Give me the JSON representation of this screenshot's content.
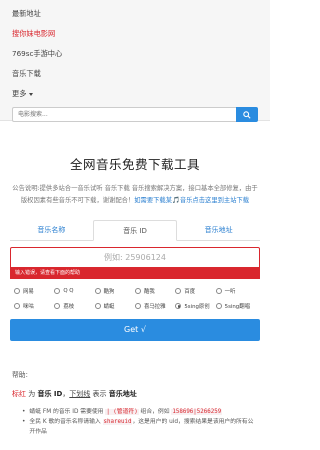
{
  "nav": {
    "items": [
      {
        "label": "最新地址",
        "active": false
      },
      {
        "label": "搜你妹电影网",
        "active": true
      },
      {
        "label": "769sc手游中心",
        "active": false
      },
      {
        "label": "音乐下载",
        "active": false
      }
    ],
    "more_label": "更多",
    "search_placeholder": "电影搜索..."
  },
  "main": {
    "title": "全网音乐免费下载工具",
    "notice_text": "公告说明:提供多站合一音乐试听 音乐下载 音乐搜索解决方案，接口基本全部修复，由于版权因素有些音乐不可下载，谢谢配合！",
    "notice_link": "如需要下载某🎵音乐点击这里到主站下载"
  },
  "tabs": [
    {
      "label": "音乐名称",
      "active": false
    },
    {
      "label": "音乐 ID",
      "active": true
    },
    {
      "label": "音乐地址",
      "active": false
    }
  ],
  "form": {
    "input_placeholder": "例如: 25906124",
    "error_text": "输入错误，请查看下面的帮助",
    "sources": [
      {
        "label": "网易",
        "checked": false
      },
      {
        "label": "Q Q",
        "checked": false
      },
      {
        "label": "酷狗",
        "checked": false
      },
      {
        "label": "酷我",
        "checked": false
      },
      {
        "label": "百度",
        "checked": false
      },
      {
        "label": "一听",
        "checked": false
      },
      {
        "label": "咪咕",
        "checked": false
      },
      {
        "label": "荔枝",
        "checked": false
      },
      {
        "label": "蜻蜓",
        "checked": false
      },
      {
        "label": "喜马拉雅",
        "checked": false
      },
      {
        "label": "5sing原创",
        "checked": true
      },
      {
        "label": "5sing翻唱",
        "checked": false
      }
    ],
    "submit_label": "Get √"
  },
  "help": {
    "title": "帮助:",
    "line_red": "标红",
    "line_part1": " 为 ",
    "line_bold1": "音乐 ID",
    "line_sep": "，",
    "line_under": "下划线",
    "line_part2": " 表示 ",
    "line_bold2": "音乐地址",
    "bullet1_pre": "蜻蜓 FM 的音乐 ID 需要使用 ",
    "bullet1_code1": "| (管道符)",
    "bullet1_mid": " 组合，例如 ",
    "bullet1_code2": "158696|5266259",
    "bullet2_pre": "全民 K 歌的音乐名称请输入 ",
    "bullet2_code": "shareuid",
    "bullet2_post": "，这是用户的 uid，搜索结果是该用户的所有公开作品"
  },
  "colors": {
    "accent": "#2a8ce0",
    "error": "#d9272e"
  }
}
